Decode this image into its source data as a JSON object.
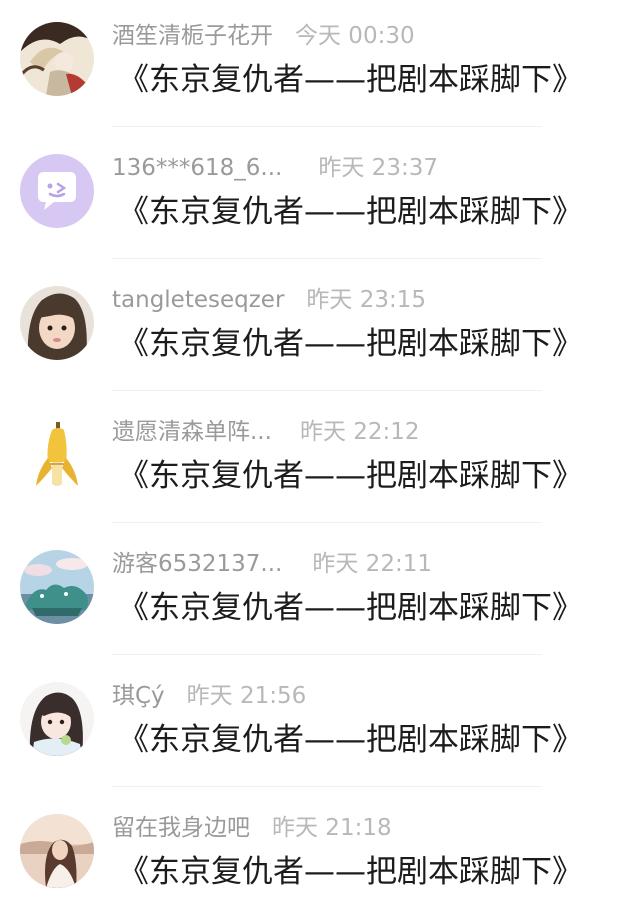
{
  "comments": [
    {
      "name": "酒笙清栀子花开",
      "time": "今天 00:30",
      "text": "《东京复仇者——把剧本踩脚下》",
      "avatar": "artwork-avatar"
    },
    {
      "name": "136***618_6...",
      "time": "昨天 23:37",
      "text": "《东京复仇者——把剧本踩脚下》",
      "avatar": "default-chat-avatar"
    },
    {
      "name": "tangleteseqzer",
      "time": "昨天 23:15",
      "text": "《东京复仇者——把剧本踩脚下》",
      "avatar": "child-photo-avatar"
    },
    {
      "name": "遗愿清森单阵...",
      "time": "昨天 22:12",
      "text": "《东京复仇者——把剧本踩脚下》",
      "avatar": "banana-avatar"
    },
    {
      "name": "游客6532137...",
      "time": "昨天 22:11",
      "text": "《东京复仇者——把剧本踩脚下》",
      "avatar": "landscape-avatar"
    },
    {
      "name": "琪Çý",
      "time": "昨天 21:56",
      "text": "《东京复仇者——把剧本踩脚下》",
      "avatar": "anime-girl-avatar"
    },
    {
      "name": "留在我身边吧",
      "time": "昨天 21:18",
      "text": "《东京复仇者——把剧本踩脚下》",
      "avatar": "photo-avatar"
    }
  ]
}
